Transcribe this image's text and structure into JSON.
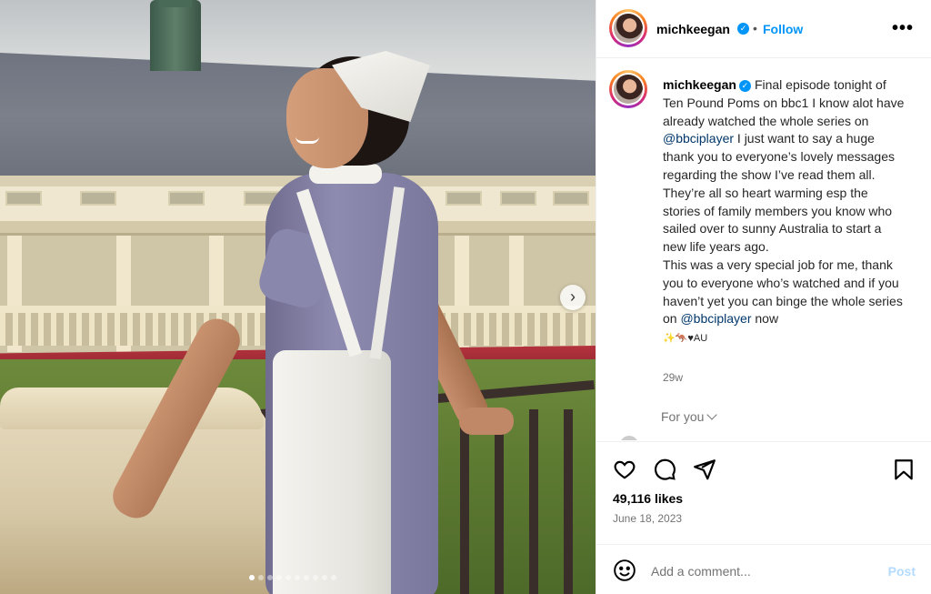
{
  "post": {
    "image_alt": "Woman in a nurse uniform on a balcony",
    "carousel_dots": 10,
    "carousel_active": 0
  },
  "header": {
    "username": "michkeegan",
    "follow_label": "Follow",
    "separator": "•",
    "more_icon": "more-horizontal-icon"
  },
  "caption": {
    "username": "michkeegan",
    "part1": "Final episode tonight of Ten Pound Poms on bbc1 I know alot have already watched the whole series on ",
    "mention1": "@bbciplayer",
    "part2": " I just want to say a huge thank you to everyone’s lovely messages regarding the show I’ve read them all. They’re all so heart warming esp the stories of family members you know who sailed over to sunny Australia to start a new life years ago.",
    "part3": "This was a very special job for me, thank you to everyone who’s watched and if you haven’t yet you can binge the whole series on ",
    "mention2": "@bbciplayer",
    "part4": " now",
    "emoji_line": "✨🦘♥AU",
    "time_ago": "29w"
  },
  "for_you": {
    "label": "For you"
  },
  "actions": {
    "likes": "49,116 likes",
    "date": "June 18, 2023"
  },
  "comment": {
    "placeholder": "Add a comment...",
    "post_label": "Post"
  },
  "colors": {
    "accent": "#0095f6",
    "mention": "#00376b",
    "muted": "#737373",
    "post_disabled": "#b3dbff"
  }
}
